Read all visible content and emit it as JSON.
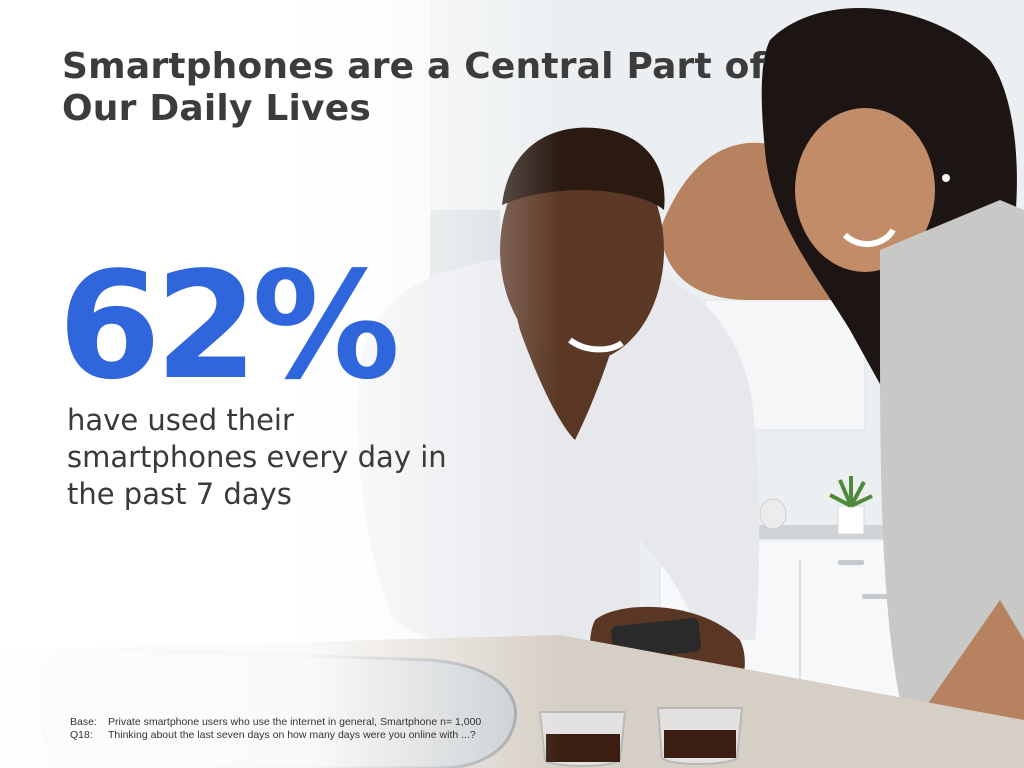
{
  "slide": {
    "title_line1": "Smartphones are a Central Part of",
    "title_line2": "Our Daily Lives",
    "stat": {
      "value": "62%",
      "caption_line1": "have used their",
      "caption_line2": "smartphones every day in",
      "caption_line3": "the past 7 days"
    },
    "footnote": {
      "base_label": "Base:",
      "base_text": "Private smartphone users who use the internet in general, Smartphone n= 1,000",
      "question_label": "Q18:",
      "question_text": "Thinking about the last seven days on how many days were you online with ...?"
    }
  },
  "colors": {
    "accent": "#2f66db",
    "title": "#3c3c3c",
    "body_text": "#3a3a3a"
  }
}
